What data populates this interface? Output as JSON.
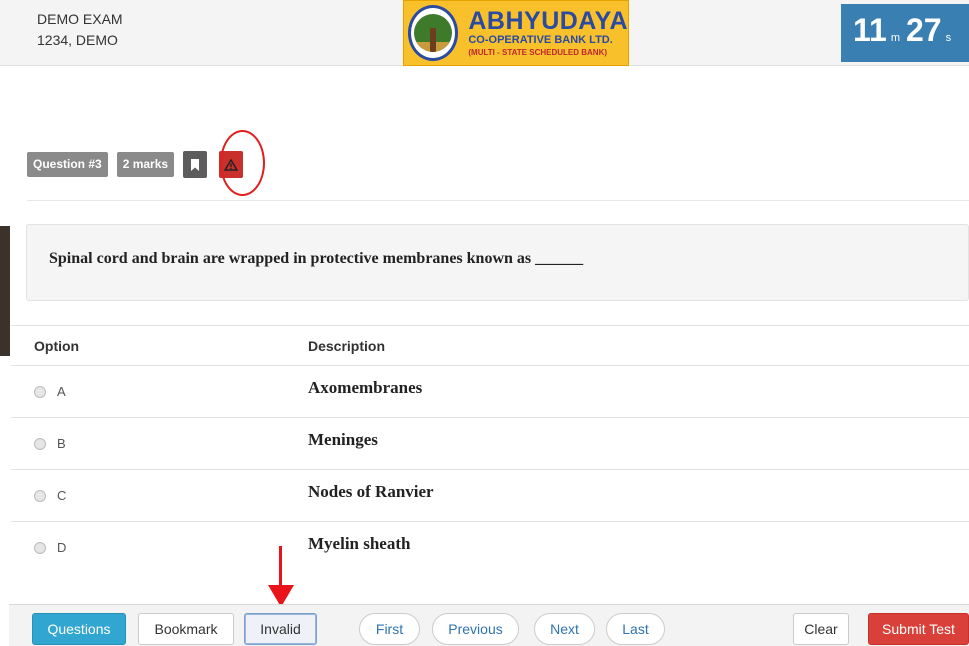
{
  "header": {
    "exam_title": "DEMO EXAM",
    "candidate": "1234, DEMO",
    "logo": {
      "title": "ABHYUDAYA",
      "subtitle": "CO-OPERATIVE BANK LTD.",
      "tagline": "(MULTI - STATE SCHEDULED BANK)"
    },
    "timer": {
      "minutes": "11",
      "minutes_unit": "m",
      "seconds": "27",
      "seconds_unit": "s"
    }
  },
  "question": {
    "number_label": "Question #3",
    "marks_label": "2 marks",
    "bookmark_icon": "bookmark-icon",
    "report_icon": "warning-triangle-icon",
    "text": "Spinal cord and brain are wrapped in protective membranes known as ______"
  },
  "options_table": {
    "headers": {
      "option": "Option",
      "description": "Description"
    },
    "rows": [
      {
        "option": "A",
        "description": "Axomembranes"
      },
      {
        "option": "B",
        "description": "Meninges"
      },
      {
        "option": "C",
        "description": "Nodes of Ranvier"
      },
      {
        "option": "D",
        "description": "Myelin sheath"
      }
    ]
  },
  "footer": {
    "questions": "Questions",
    "bookmark": "Bookmark",
    "invalid": "Invalid",
    "first": "First",
    "previous": "Previous",
    "next": "Next",
    "last": "Last",
    "clear": "Clear",
    "submit": "Submit Test"
  },
  "colors": {
    "timer_bg": "#3a7fb1",
    "badge_gray": "#8a8a8a",
    "report_red": "#c9302c",
    "questions_blue": "#31a6d1",
    "submit_red": "#d9403a",
    "annotation_red": "#e8131b"
  }
}
